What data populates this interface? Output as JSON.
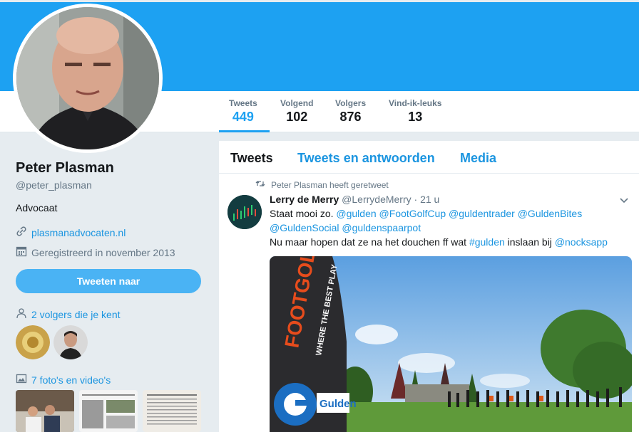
{
  "profile": {
    "name": "Peter Plasman",
    "handle": "@peter_plasman",
    "bio": "Advocaat",
    "website": "plasmanadvocaten.nl",
    "joined": "Geregistreerd in november 2013",
    "tweet_to_label": "Tweeten naar",
    "followers_you_know": "2 volgers die je kent",
    "photos_videos": "7 foto's en video's"
  },
  "stats": [
    {
      "label": "Tweets",
      "value": "449"
    },
    {
      "label": "Volgend",
      "value": "102"
    },
    {
      "label": "Volgers",
      "value": "876"
    },
    {
      "label": "Vind-ik-leuks",
      "value": "13"
    }
  ],
  "timeline": {
    "tabs": [
      "Tweets",
      "Tweets en antwoorden",
      "Media"
    ]
  },
  "tweet": {
    "retweet_context": "Peter Plasman heeft geretweet",
    "author": "Lerry de Merry",
    "handle": "@LerrydeMerry",
    "time": "· 21 u",
    "line1_prefix": "Staat mooi zo. ",
    "line1_mentions": "@gulden @FootGolfCup @guldentrader @GuldenBites",
    "line2_mentions": "@GuldenSocial @guldenspaarpot",
    "line3_a": "Nu maar hopen dat ze na het douchen ff wat ",
    "line3_tag": "#gulden",
    "line3_b": " inslaan bij ",
    "line3_mention": "@nocksapp",
    "media": {
      "banner_text": "FOOTGOLF",
      "banner_subtext": "WHERE THE BEST PLAY",
      "brand": "Gulden"
    }
  },
  "colors": {
    "accent": "#1da1f2",
    "link": "#1b95e0",
    "muted": "#657786"
  }
}
